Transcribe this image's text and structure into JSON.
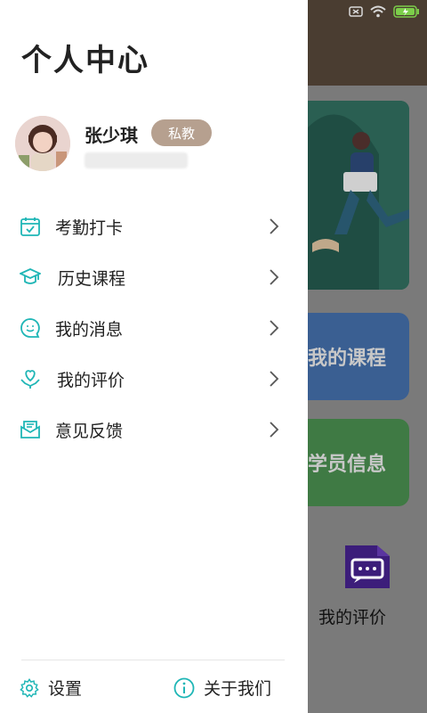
{
  "drawer": {
    "title": "个人中心",
    "user": {
      "name": "张少琪",
      "badge": "私教"
    },
    "menu": [
      {
        "label": "考勤打卡",
        "icon": "calendar-check-icon"
      },
      {
        "label": "历史课程",
        "icon": "graduation-cap-icon"
      },
      {
        "label": "我的消息",
        "icon": "chat-bubble-icon"
      },
      {
        "label": "我的评价",
        "icon": "hands-heart-icon"
      },
      {
        "label": "意见反馈",
        "icon": "mail-feedback-icon"
      }
    ],
    "footer": {
      "settings_label": "设置",
      "about_label": "关于我们"
    }
  },
  "background": {
    "my_courses_label": "我的课程",
    "student_info_label": "学员信息",
    "my_reviews_label": "我的评价"
  },
  "colors": {
    "accent": "#1fb6b6",
    "badge": "#b6a08f",
    "tile_blue": "#3a5f92",
    "tile_green": "#3f7a44",
    "review_icon": "#3c1d7a"
  }
}
